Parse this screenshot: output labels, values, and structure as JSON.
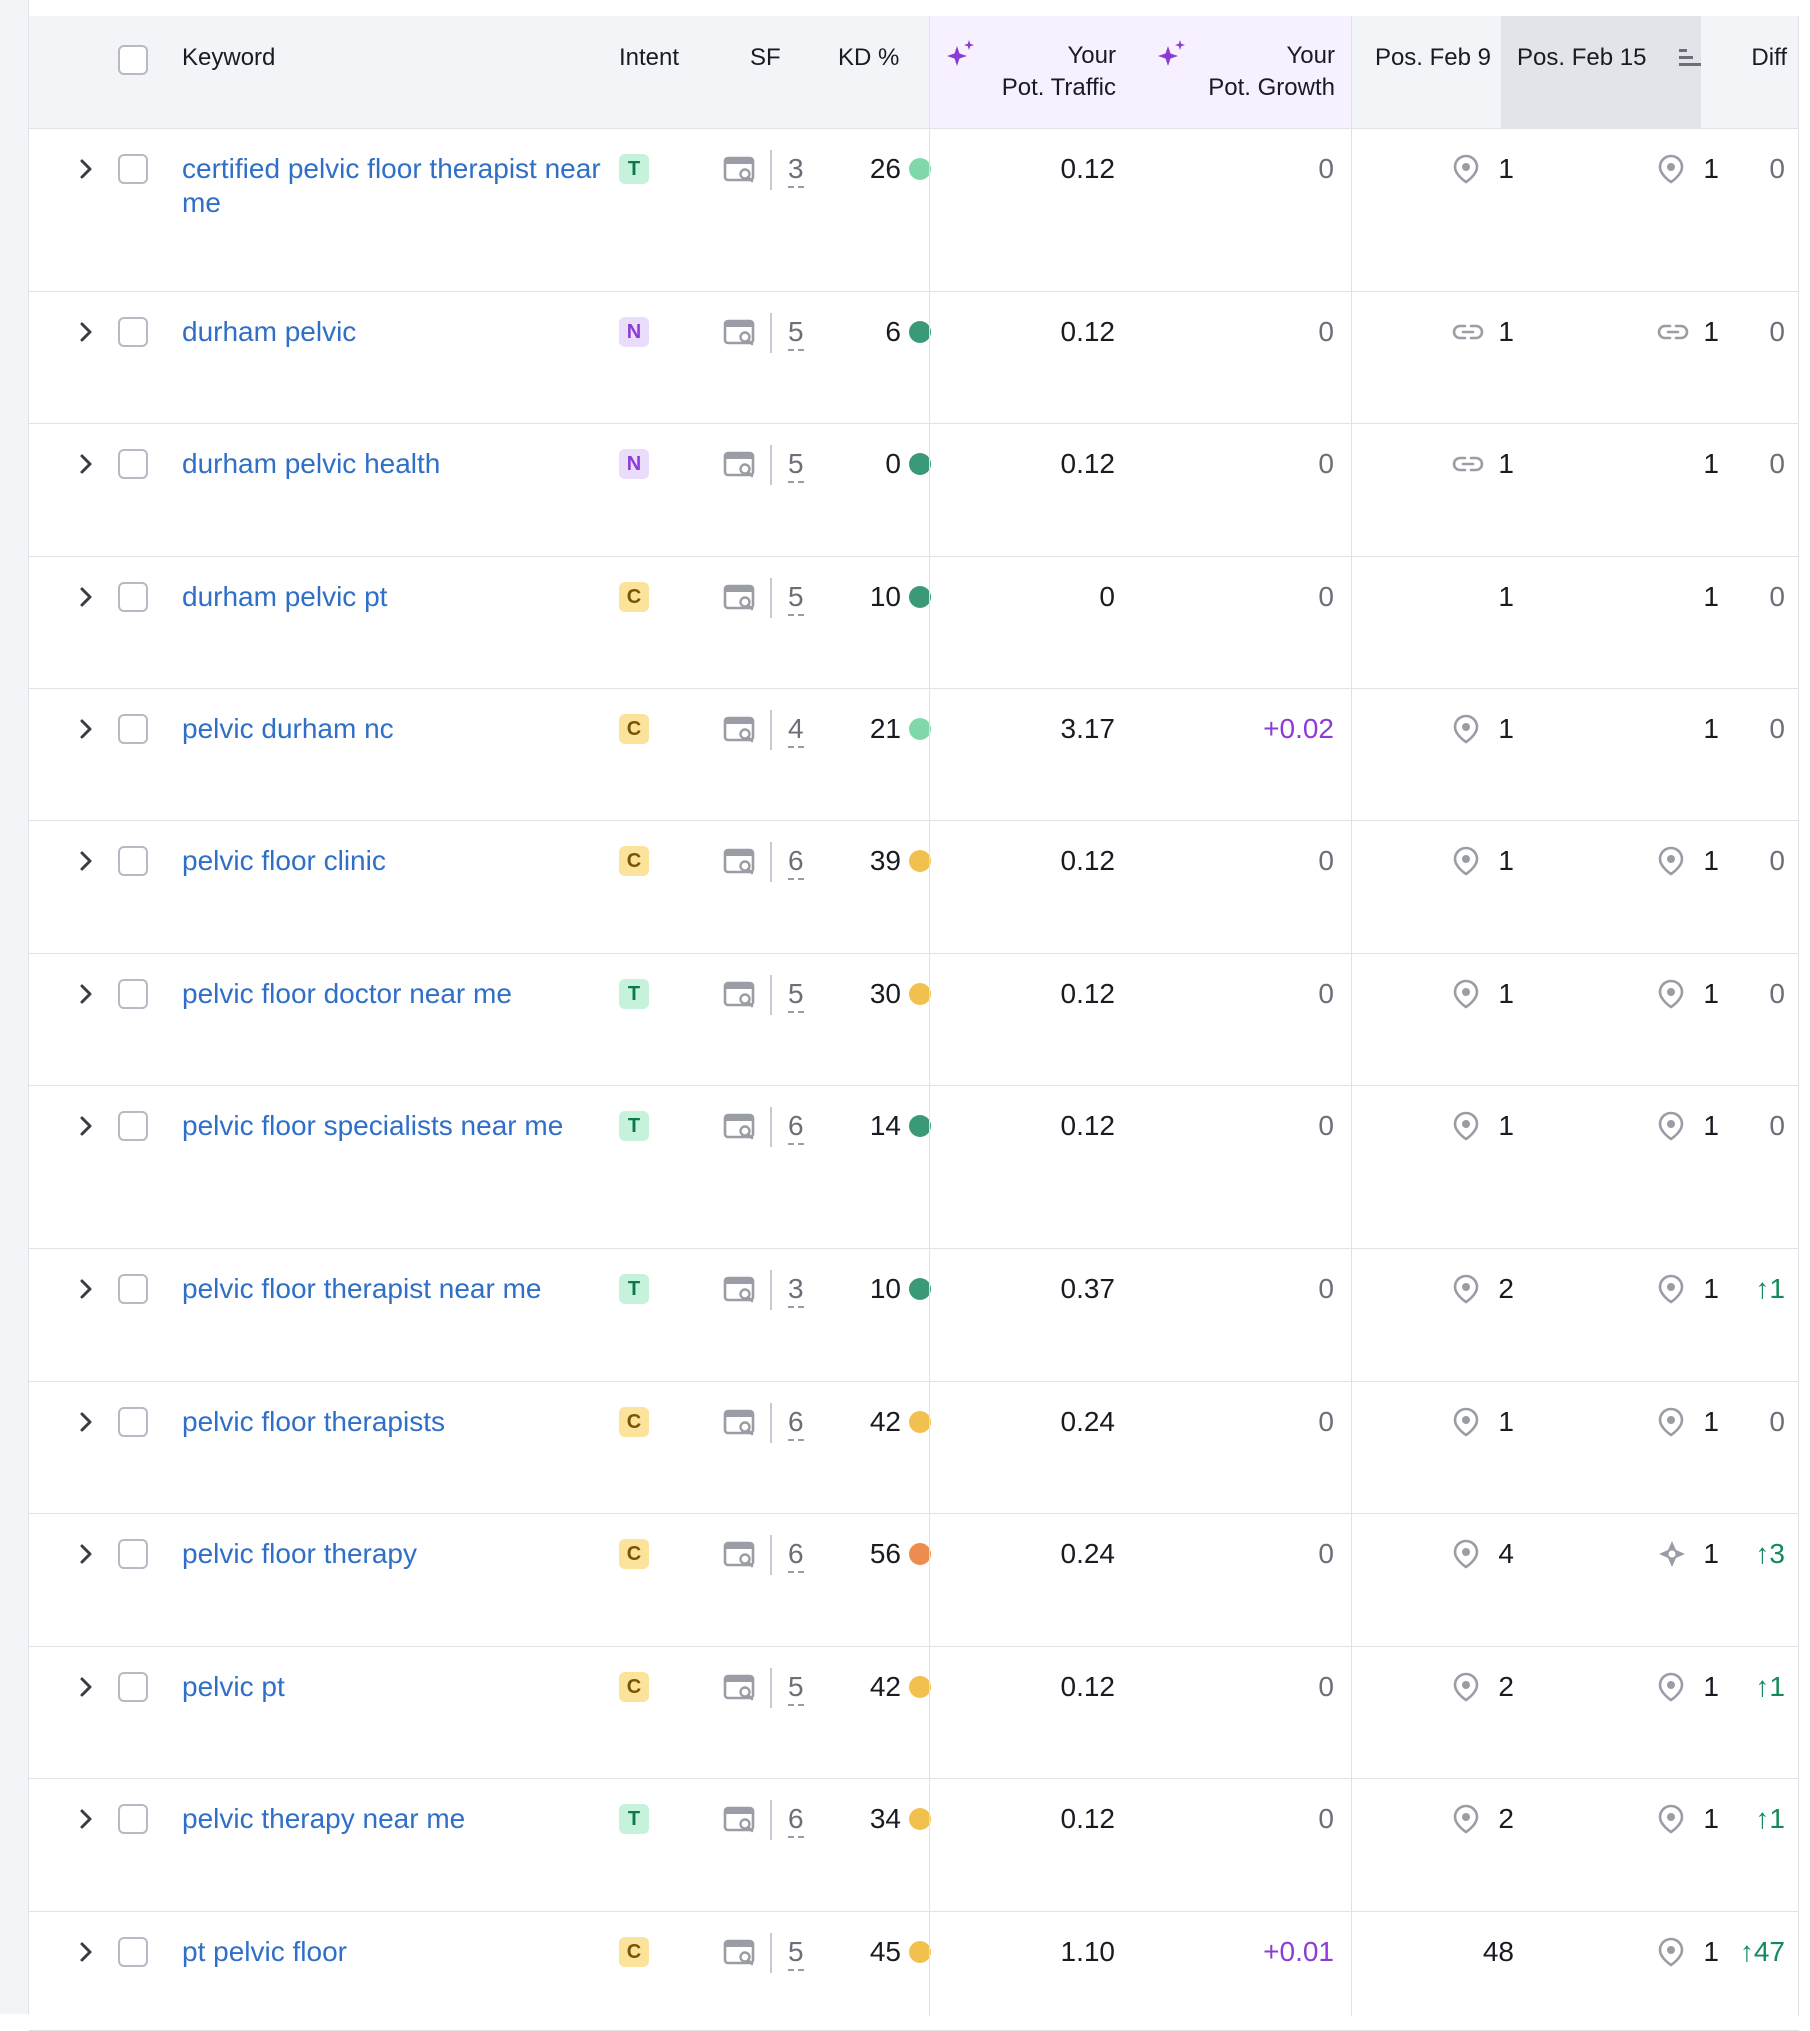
{
  "columns": {
    "keyword": "Keyword",
    "intent": "Intent",
    "sf": "SF",
    "kd": "KD %",
    "pot_traffic_1": "Your",
    "pot_traffic_2": "Pot. Traffic",
    "pot_growth_1": "Your",
    "pot_growth_2": "Pot. Growth",
    "pos_feb9": "Pos. Feb 9",
    "pos_feb15": "Pos. Feb 15",
    "diff": "Diff"
  },
  "colors": {
    "kd_green_light": "#7fd8a8",
    "kd_green_dark": "#3a9a78",
    "kd_yellow": "#f2c04f",
    "kd_orange": "#ec8c4f"
  },
  "rows": [
    {
      "keyword": "certified pelvic floor therapist near me",
      "intent": "T",
      "sf": "3",
      "kd": "26",
      "kd_color": "#7fd8a8",
      "traffic": "0.12",
      "growth": "0",
      "pos9_icon": "pin",
      "pos9": "1",
      "pos15_icon": "pin",
      "pos15": "1",
      "diff": "0"
    },
    {
      "keyword": "durham pelvic",
      "intent": "N",
      "sf": "5",
      "kd": "6",
      "kd_color": "#3a9a78",
      "traffic": "0.12",
      "growth": "0",
      "pos9_icon": "link",
      "pos9": "1",
      "pos15_icon": "link",
      "pos15": "1",
      "diff": "0"
    },
    {
      "keyword": "durham pelvic health",
      "intent": "N",
      "sf": "5",
      "kd": "0",
      "kd_color": "#3a9a78",
      "traffic": "0.12",
      "growth": "0",
      "pos9_icon": "link",
      "pos9": "1",
      "pos15_icon": "",
      "pos15": "1",
      "diff": "0"
    },
    {
      "keyword": "durham pelvic pt",
      "intent": "C",
      "sf": "5",
      "kd": "10",
      "kd_color": "#3a9a78",
      "traffic": "0",
      "growth": "0",
      "pos9_icon": "",
      "pos9": "1",
      "pos15_icon": "",
      "pos15": "1",
      "diff": "0"
    },
    {
      "keyword": "pelvic durham nc",
      "intent": "C",
      "sf": "4",
      "kd": "21",
      "kd_color": "#7fd8a8",
      "traffic": "3.17",
      "growth": "+0.02",
      "pos9_icon": "pin",
      "pos9": "1",
      "pos15_icon": "",
      "pos15": "1",
      "diff": "0"
    },
    {
      "keyword": "pelvic floor clinic",
      "intent": "C",
      "sf": "6",
      "kd": "39",
      "kd_color": "#f2c04f",
      "traffic": "0.12",
      "growth": "0",
      "pos9_icon": "pin",
      "pos9": "1",
      "pos15_icon": "pin",
      "pos15": "1",
      "diff": "0"
    },
    {
      "keyword": "pelvic floor doctor near me",
      "intent": "T",
      "sf": "5",
      "kd": "30",
      "kd_color": "#f2c04f",
      "traffic": "0.12",
      "growth": "0",
      "pos9_icon": "pin",
      "pos9": "1",
      "pos15_icon": "pin",
      "pos15": "1",
      "diff": "0"
    },
    {
      "keyword": "pelvic floor specialists near me",
      "intent": "T",
      "sf": "6",
      "kd": "14",
      "kd_color": "#3a9a78",
      "traffic": "0.12",
      "growth": "0",
      "pos9_icon": "pin",
      "pos9": "1",
      "pos15_icon": "pin",
      "pos15": "1",
      "diff": "0"
    },
    {
      "keyword": "pelvic floor therapist near me",
      "intent": "T",
      "sf": "3",
      "kd": "10",
      "kd_color": "#3a9a78",
      "traffic": "0.37",
      "growth": "0",
      "pos9_icon": "pin",
      "pos9": "2",
      "pos15_icon": "pin",
      "pos15": "1",
      "diff": "↑1"
    },
    {
      "keyword": "pelvic floor therapists",
      "intent": "C",
      "sf": "6",
      "kd": "42",
      "kd_color": "#f2c04f",
      "traffic": "0.24",
      "growth": "0",
      "pos9_icon": "pin",
      "pos9": "1",
      "pos15_icon": "pin",
      "pos15": "1",
      "diff": "0"
    },
    {
      "keyword": "pelvic floor therapy",
      "intent": "C",
      "sf": "6",
      "kd": "56",
      "kd_color": "#ec8c4f",
      "traffic": "0.24",
      "growth": "0",
      "pos9_icon": "pin",
      "pos9": "4",
      "pos15_icon": "star",
      "pos15": "1",
      "diff": "↑3"
    },
    {
      "keyword": "pelvic pt",
      "intent": "C",
      "sf": "5",
      "kd": "42",
      "kd_color": "#f2c04f",
      "traffic": "0.12",
      "growth": "0",
      "pos9_icon": "pin",
      "pos9": "2",
      "pos15_icon": "pin",
      "pos15": "1",
      "diff": "↑1"
    },
    {
      "keyword": "pelvic therapy near me",
      "intent": "T",
      "sf": "6",
      "kd": "34",
      "kd_color": "#f2c04f",
      "traffic": "0.12",
      "growth": "0",
      "pos9_icon": "pin",
      "pos9": "2",
      "pos15_icon": "pin",
      "pos15": "1",
      "diff": "↑1"
    },
    {
      "keyword": "pt pelvic floor",
      "intent": "C",
      "sf": "5",
      "kd": "45",
      "kd_color": "#f2c04f",
      "traffic": "1.10",
      "growth": "+0.01",
      "pos9_icon": "",
      "pos9": "48",
      "pos15_icon": "pin",
      "pos15": "1",
      "diff": "↑47"
    }
  ]
}
